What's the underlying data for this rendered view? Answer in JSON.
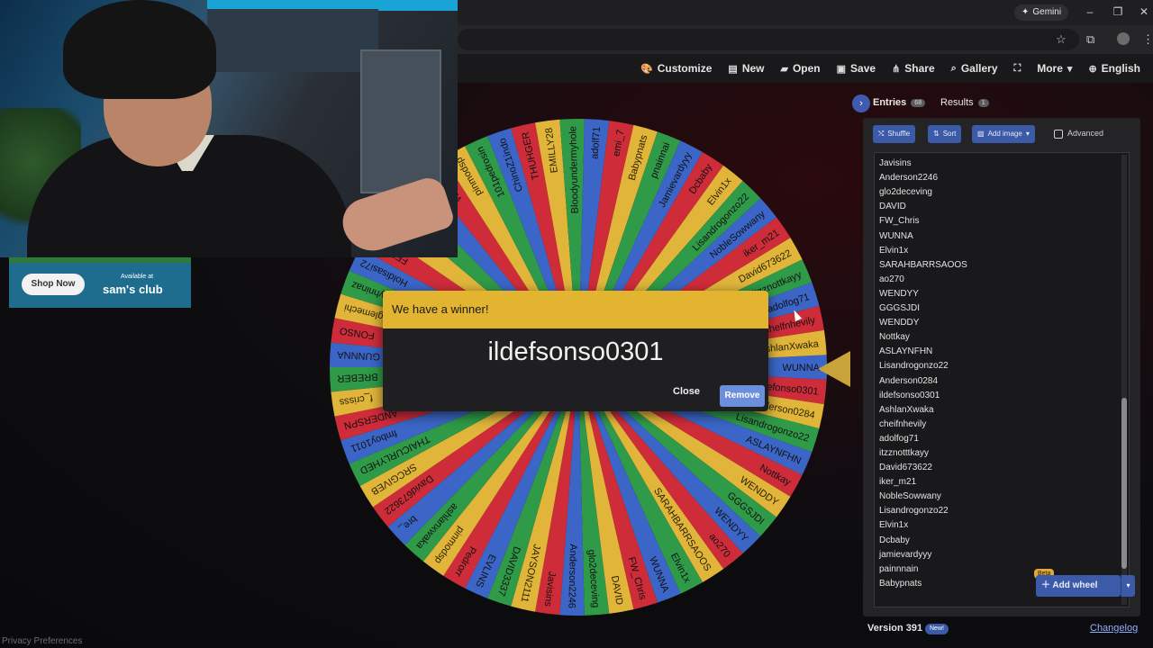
{
  "browser": {
    "gemini_label": "Gemini",
    "minimize": "–",
    "restore": "❐",
    "close": "✕",
    "star": "☆",
    "ext": "⧉",
    "menu": "⋮"
  },
  "toolbar": {
    "customize": "Customize",
    "new": "New",
    "open": "Open",
    "save": "Save",
    "share": "Share",
    "gallery": "Gallery",
    "fullscreen": "⛶",
    "more": "More",
    "language": "English"
  },
  "ad": {
    "shop_now": "Shop Now",
    "available_at": "Available at",
    "brand": "sam's club"
  },
  "wheel": {
    "colors": [
      "#3b66c8",
      "#cf2c3a",
      "#e0b53a",
      "#2f9a48"
    ],
    "visible_segment_labels": [
      "WUNNA",
      "ildefonso0301",
      "Anderson0284",
      "Lisandrogonzo22",
      "ASLAYNFHN",
      "Nottkay",
      "WENDDY",
      "GGGSJDI",
      "WENDYY",
      "ao270",
      "SARAHBARRSAOOS",
      "Elvin1x",
      "WUNNA",
      "FW_Chris",
      "DAVID",
      "glo2deceving",
      "Anderson2246",
      "Javisins",
      "JAYSON2111",
      "DAVID3337",
      "EVLINS",
      "Pedrorr",
      "pinmodsp",
      "ashlanxwaka",
      "bre_",
      "David673622",
      "SRCGIVEB",
      "THAICURLYHED",
      "fmboy1011",
      "ANDERSPN",
      "f_crisss",
      "BREBER",
      "GUNNNA",
      "FONSO",
      "glemechi",
      "lyhninaz",
      "Holdisasi72",
      "FEPONS",
      "FmilyNGA",
      "LION",
      "Jaimei",
      "WUNNA",
      "pinmodsp",
      "101pedrosin",
      "ChinoZ1indo",
      "THUHGER",
      "EMILLY28",
      "Bloodyundermyhole",
      "adolf71",
      "emi_7",
      "Babypnats",
      "pnainnai",
      "Jamievardyyy",
      "Dcbaby",
      "Elvin1x",
      "Lisandrogonzo22",
      "NobleSowwany",
      "iker_m21",
      "David673622",
      "itzznottkayy",
      "adolfog71",
      "chelfnhevily",
      "AshlanXwaka"
    ]
  },
  "dialog": {
    "title": "We have a winner!",
    "winner": "ildefsonso0301",
    "close": "Close",
    "remove": "Remove"
  },
  "panel": {
    "entries_tab": "Entries",
    "entries_count": "68",
    "results_tab": "Results",
    "results_count": "1",
    "shuffle": "Shuffle",
    "sort": "Sort",
    "add_image": "Add image",
    "advanced": "Advanced",
    "entries": [
      "JAYSON2111",
      "Javisins",
      "Anderson2246",
      "glo2deceving",
      "DAVID",
      "FW_Chris",
      "WUNNA",
      "Elvin1x",
      "SARAHBARRSAOOS",
      "ao270",
      "WENDYY",
      "GGGSJDI",
      "WENDDY",
      "Nottkay",
      "ASLAYNFHN",
      "Lisandrogonzo22",
      "Anderson0284",
      "ildefsonso0301",
      "AshlanXwaka",
      "cheifnhevily",
      "adolfog71",
      "itzznotttkayy",
      "David673622",
      "iker_m21",
      "NobleSowwany",
      "Lisandrogonzo22",
      "Elvin1x",
      "Dcbaby",
      "jamievardyyy",
      "painnnain",
      "Babypnats"
    ],
    "add_wheel": "Add wheel",
    "beta": "Beta",
    "version": "Version 391",
    "new_badge": "New!",
    "changelog": "Changelog"
  },
  "footer": {
    "privacy": "Privacy Preferences"
  }
}
